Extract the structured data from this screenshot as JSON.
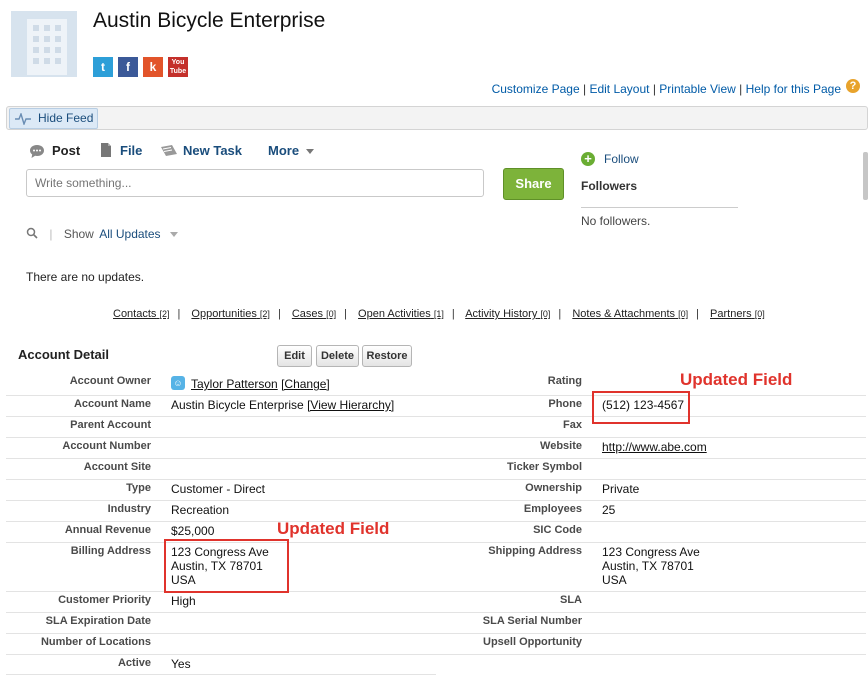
{
  "header": {
    "title": "Austin Bicycle Enterprise",
    "social": [
      {
        "icon": "twitter-icon",
        "glyph": "t",
        "color": "#2d9fd8"
      },
      {
        "icon": "facebook-icon",
        "glyph": "f",
        "color": "#3b5998"
      },
      {
        "icon": "klout-icon",
        "glyph": "k",
        "color": "#e2542a"
      },
      {
        "icon": "youtube-icon",
        "glyph": "You Tube",
        "color": "#c4302b"
      }
    ],
    "links": [
      "Customize Page",
      "Edit Layout",
      "Printable View",
      "Help for this Page"
    ],
    "separator": "|",
    "help_glyph": "?"
  },
  "feed": {
    "hide_feed": "Hide Feed",
    "post": "Post",
    "file": "File",
    "new_task": "New Task",
    "more": "More",
    "placeholder": "Write something...",
    "share": "Share",
    "follow": "Follow",
    "followers": "Followers",
    "no_followers": "No followers.",
    "show_label": "Show",
    "show_value": "All Updates",
    "no_updates": "There are no updates."
  },
  "related": [
    {
      "label": "Contacts",
      "count": "[2]"
    },
    {
      "label": "Opportunities",
      "count": "[2]"
    },
    {
      "label": "Cases",
      "count": "[0]"
    },
    {
      "label": "Open Activities",
      "count": "[1]"
    },
    {
      "label": "Activity History",
      "count": "[0]"
    },
    {
      "label": "Notes & Attachments",
      "count": "[0]"
    },
    {
      "label": "Partners",
      "count": "[0]"
    }
  ],
  "detail": {
    "title": "Account Detail",
    "buttons": {
      "edit": "Edit",
      "delete": "Delete",
      "restore": "Restore"
    },
    "annotation": "Updated Field",
    "fields": {
      "account_owner": {
        "label": "Account Owner",
        "value": "Taylor Patterson",
        "action": "[Change]"
      },
      "rating": {
        "label": "Rating",
        "value": ""
      },
      "account_name": {
        "label": "Account Name",
        "value": "Austin Bicycle Enterprise",
        "action": "[View Hierarchy]"
      },
      "phone": {
        "label": "Phone",
        "value": "(512) 123-4567"
      },
      "parent_account": {
        "label": "Parent Account",
        "value": ""
      },
      "fax": {
        "label": "Fax",
        "value": ""
      },
      "account_number": {
        "label": "Account Number",
        "value": ""
      },
      "website": {
        "label": "Website",
        "value": "http://www.abe.com"
      },
      "account_site": {
        "label": "Account Site",
        "value": ""
      },
      "ticker_symbol": {
        "label": "Ticker Symbol",
        "value": ""
      },
      "type": {
        "label": "Type",
        "value": "Customer - Direct"
      },
      "ownership": {
        "label": "Ownership",
        "value": "Private"
      },
      "industry": {
        "label": "Industry",
        "value": "Recreation"
      },
      "employees": {
        "label": "Employees",
        "value": "25"
      },
      "annual_revenue": {
        "label": "Annual Revenue",
        "value": "$25,000"
      },
      "sic_code": {
        "label": "SIC Code",
        "value": ""
      },
      "billing_address": {
        "label": "Billing Address",
        "line1": "123 Congress Ave",
        "line2": "Austin, TX 78701",
        "line3": "USA"
      },
      "shipping_address": {
        "label": "Shipping Address",
        "line1": "123 Congress Ave",
        "line2": "Austin, TX 78701",
        "line3": "USA"
      },
      "customer_priority": {
        "label": "Customer Priority",
        "value": "High"
      },
      "sla": {
        "label": "SLA",
        "value": ""
      },
      "sla_expiration": {
        "label": "SLA Expiration Date",
        "value": ""
      },
      "sla_serial": {
        "label": "SLA Serial Number",
        "value": ""
      },
      "num_locations": {
        "label": "Number of Locations",
        "value": ""
      },
      "upsell": {
        "label": "Upsell Opportunity",
        "value": ""
      },
      "active": {
        "label": "Active",
        "value": "Yes"
      }
    }
  }
}
